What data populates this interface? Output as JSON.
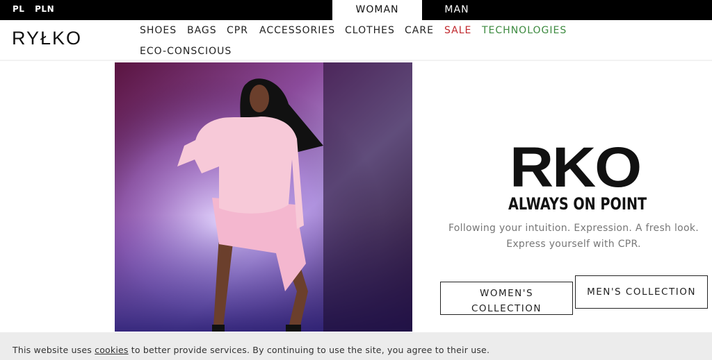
{
  "topbar": {
    "locale": {
      "language": "PL",
      "currency": "PLN"
    },
    "tabs": [
      {
        "label": "WOMAN",
        "active": true
      },
      {
        "label": "MAN",
        "active": false
      }
    ]
  },
  "header": {
    "logo": "RYŁKO",
    "nav": [
      {
        "label": "SHOES"
      },
      {
        "label": "BAGS"
      },
      {
        "label": "CPR"
      },
      {
        "label": "ACCESSORIES"
      },
      {
        "label": "CLOTHES"
      },
      {
        "label": "CARE"
      },
      {
        "label": "SALE"
      },
      {
        "label": "TECHNOLOGIES"
      },
      {
        "label": "ECO-CONSCIOUS"
      }
    ]
  },
  "promo": {
    "brand": "RKO",
    "tagline": "ALWAYS ON POINT",
    "copy_line1": "Following your intuition. Expression. A fresh look.",
    "copy_line2": "Express yourself with CPR.",
    "women_button_line1": "WOMEN'S",
    "women_button_line2": "COLLECTION",
    "men_button": "MEN'S COLLECTION"
  },
  "cookie_bar": {
    "text_before": "This website uses ",
    "link": "cookies",
    "text_after": " to better provide services. By continuing to use the site, you agree to their use."
  },
  "colors": {
    "sale": "#c0282d",
    "technologies": "#3c8a3f",
    "topbar": "#000000"
  }
}
